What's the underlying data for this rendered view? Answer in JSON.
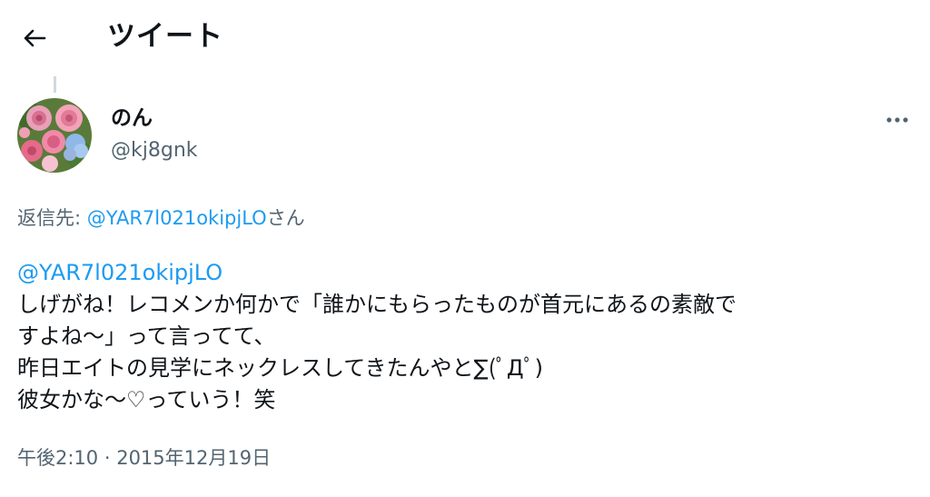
{
  "header": {
    "title": "ツイート",
    "back_icon": "arrow-left-icon"
  },
  "tweet": {
    "author": {
      "display_name": "のん",
      "handle": "@kj8gnk",
      "avatar": "flower-bouquet-avatar"
    },
    "more_icon": "more-horizontal-icon",
    "reply_to": {
      "prefix": "返信先: ",
      "mention": "@YAR7l021okipjLO",
      "suffix": "さん"
    },
    "body": {
      "mention": "@YAR7l021okipjLO",
      "lines": [
        "しげがね！レコメンか何かで「誰かにもらったものが首元にあるの素敵で",
        "すよね〜」って言ってて、",
        "昨日エイトの見学にネックレスしてきたんやと∑(ﾟДﾟ)",
        "彼女かな〜♡っていう！笑"
      ]
    },
    "time": "午後2:10",
    "separator": " · ",
    "date": "2015年12月19日"
  },
  "colors": {
    "text": "#0f1419",
    "secondary": "#536471",
    "link": "#1d9bf0",
    "thread_line": "#cfd9de"
  }
}
